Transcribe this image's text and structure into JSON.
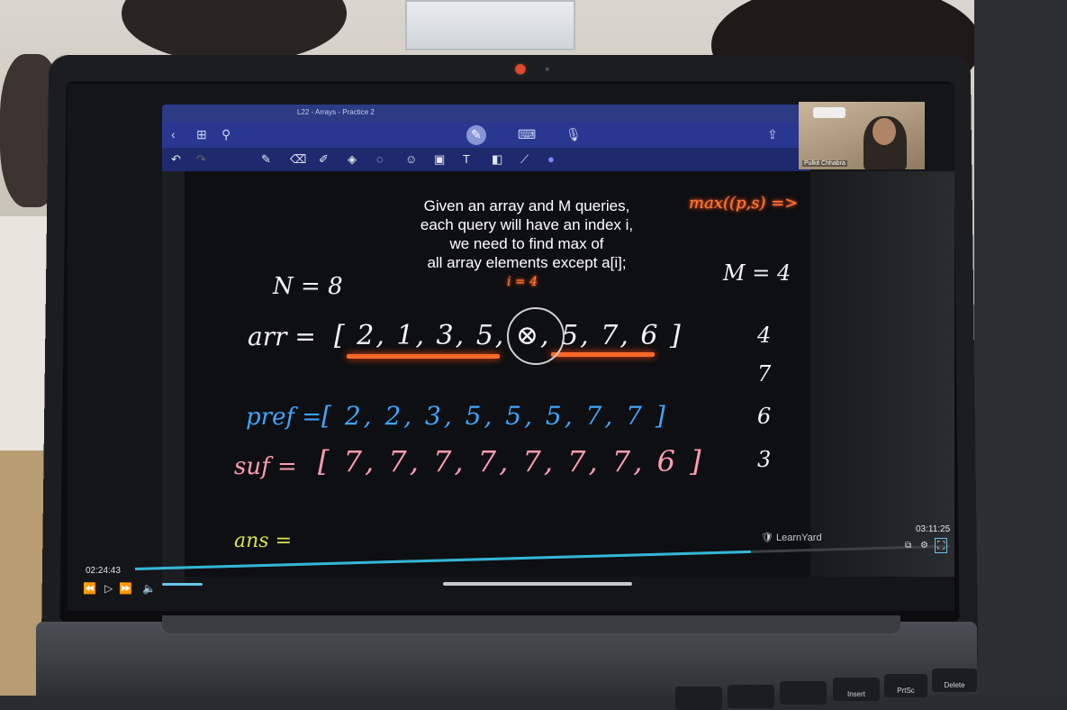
{
  "app": {
    "tab_title": "L22 - Arrays - Practice 2",
    "presenter": "Pulkit Chhabra",
    "brand": "LearnYard"
  },
  "icons": {
    "back": "chevron-left-icon",
    "grid": "grid-icon",
    "search": "search-icon",
    "pen": "pen-icon",
    "keyboard": "keyboard-icon",
    "mic": "mic-icon",
    "share": "share-icon",
    "undo": "undo-icon",
    "redo": "redo-icon",
    "eraser": "eraser-icon",
    "highlighter": "highlighter-icon",
    "shapes": "shapes-icon",
    "lasso": "lasso-icon",
    "image": "image-icon",
    "text": "text-icon",
    "ruler": "ruler-icon",
    "play": "play-icon",
    "rewind": "rewind-icon",
    "forward": "forward-icon",
    "volume": "volume-icon",
    "pip": "picture-in-picture-icon",
    "settings": "gear-icon",
    "fullscreen": "fullscreen-icon"
  },
  "question": {
    "line1": "Given an array and M queries,",
    "line2": "each query will have an index i,",
    "line3": "we need to find max of",
    "line4": "all array elements except a[i];"
  },
  "notes": {
    "n_eq": "N = 8",
    "m_eq": "M = 4",
    "arr_label": "arr =",
    "arr_values": "[ 2, 1, 3, 5, ⊗, 5, 7, 6 ]",
    "i_marker": "i = 4",
    "corner": "max((p,s) =>",
    "pref_label": "pref =",
    "pref_values": "[ 2, 2, 3, 5, 5, 5, 7, 7 ]",
    "suf_label": "suf =",
    "suf_values": "[ 7, 7, 7, 7, 7, 7, 7, 6 ]",
    "ans_label": "ans =",
    "queries": [
      "4",
      "7",
      "6",
      "3"
    ]
  },
  "player": {
    "elapsed": "02:24:43",
    "duration": "03:11:25",
    "progress": 0.756
  },
  "keys": [
    "Delete",
    "PrtSc",
    "Insert"
  ]
}
